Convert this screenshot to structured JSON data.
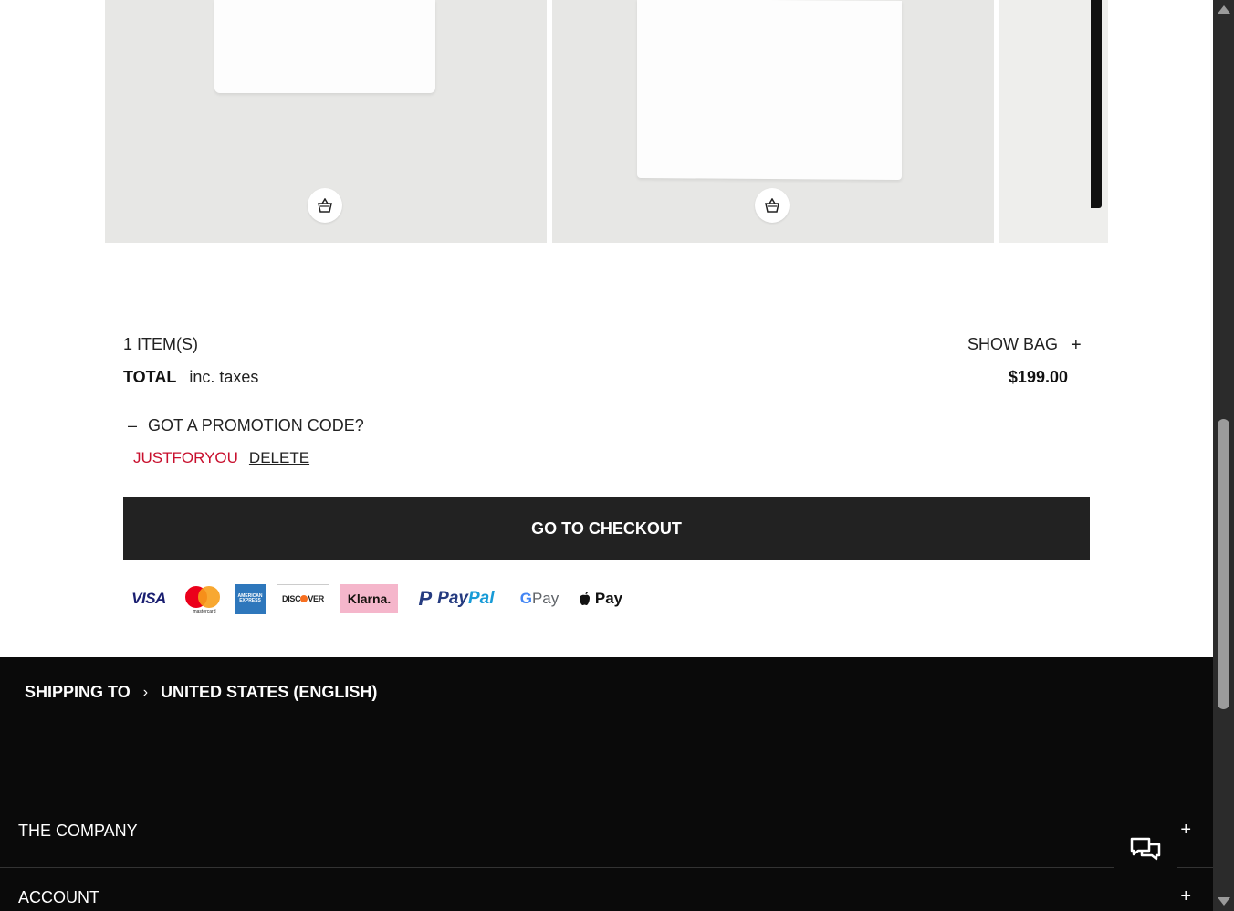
{
  "bag": {
    "items_count": "1 ITEM(S)",
    "show_bag": "SHOW BAG",
    "show_bag_icon": "+",
    "total_label": "TOTAL",
    "total_note": "inc. taxes",
    "total_price": "$199.00"
  },
  "promo": {
    "toggle_icon": "–",
    "toggle_label": "GOT A PROMOTION CODE?",
    "applied_code": "JUSTFORYOU",
    "delete_label": "DELETE"
  },
  "checkout": {
    "label": "GO TO CHECKOUT"
  },
  "payments": {
    "visa": "VISA",
    "mastercard": "mastercard",
    "amex": "AMERICAN EXPRESS",
    "discover_a": "DISC",
    "discover_b": "VER",
    "klarna": "Klarna.",
    "paypal_a": "Pay",
    "paypal_b": "Pal",
    "paypal_mark": "P",
    "gpay_g": "G",
    "gpay_pay": "Pay",
    "apple_mark": "",
    "apple_pay": "Pay"
  },
  "footer": {
    "shipping_label": "SHIPPING TO",
    "shipping_chevron": "›",
    "shipping_region": "UNITED STATES (ENGLISH)",
    "sections": [
      {
        "label": "THE COMPANY",
        "icon": "+"
      },
      {
        "label": "ACCOUNT",
        "icon": "+"
      }
    ]
  },
  "colors": {
    "promo_code": "#c8102e",
    "checkout_bg": "#222222",
    "footer_bg": "#0a0a0a"
  },
  "icons": [
    "shopping-bag-icon",
    "plus-icon",
    "minus-icon",
    "chevron-right-icon",
    "chat-icon"
  ]
}
